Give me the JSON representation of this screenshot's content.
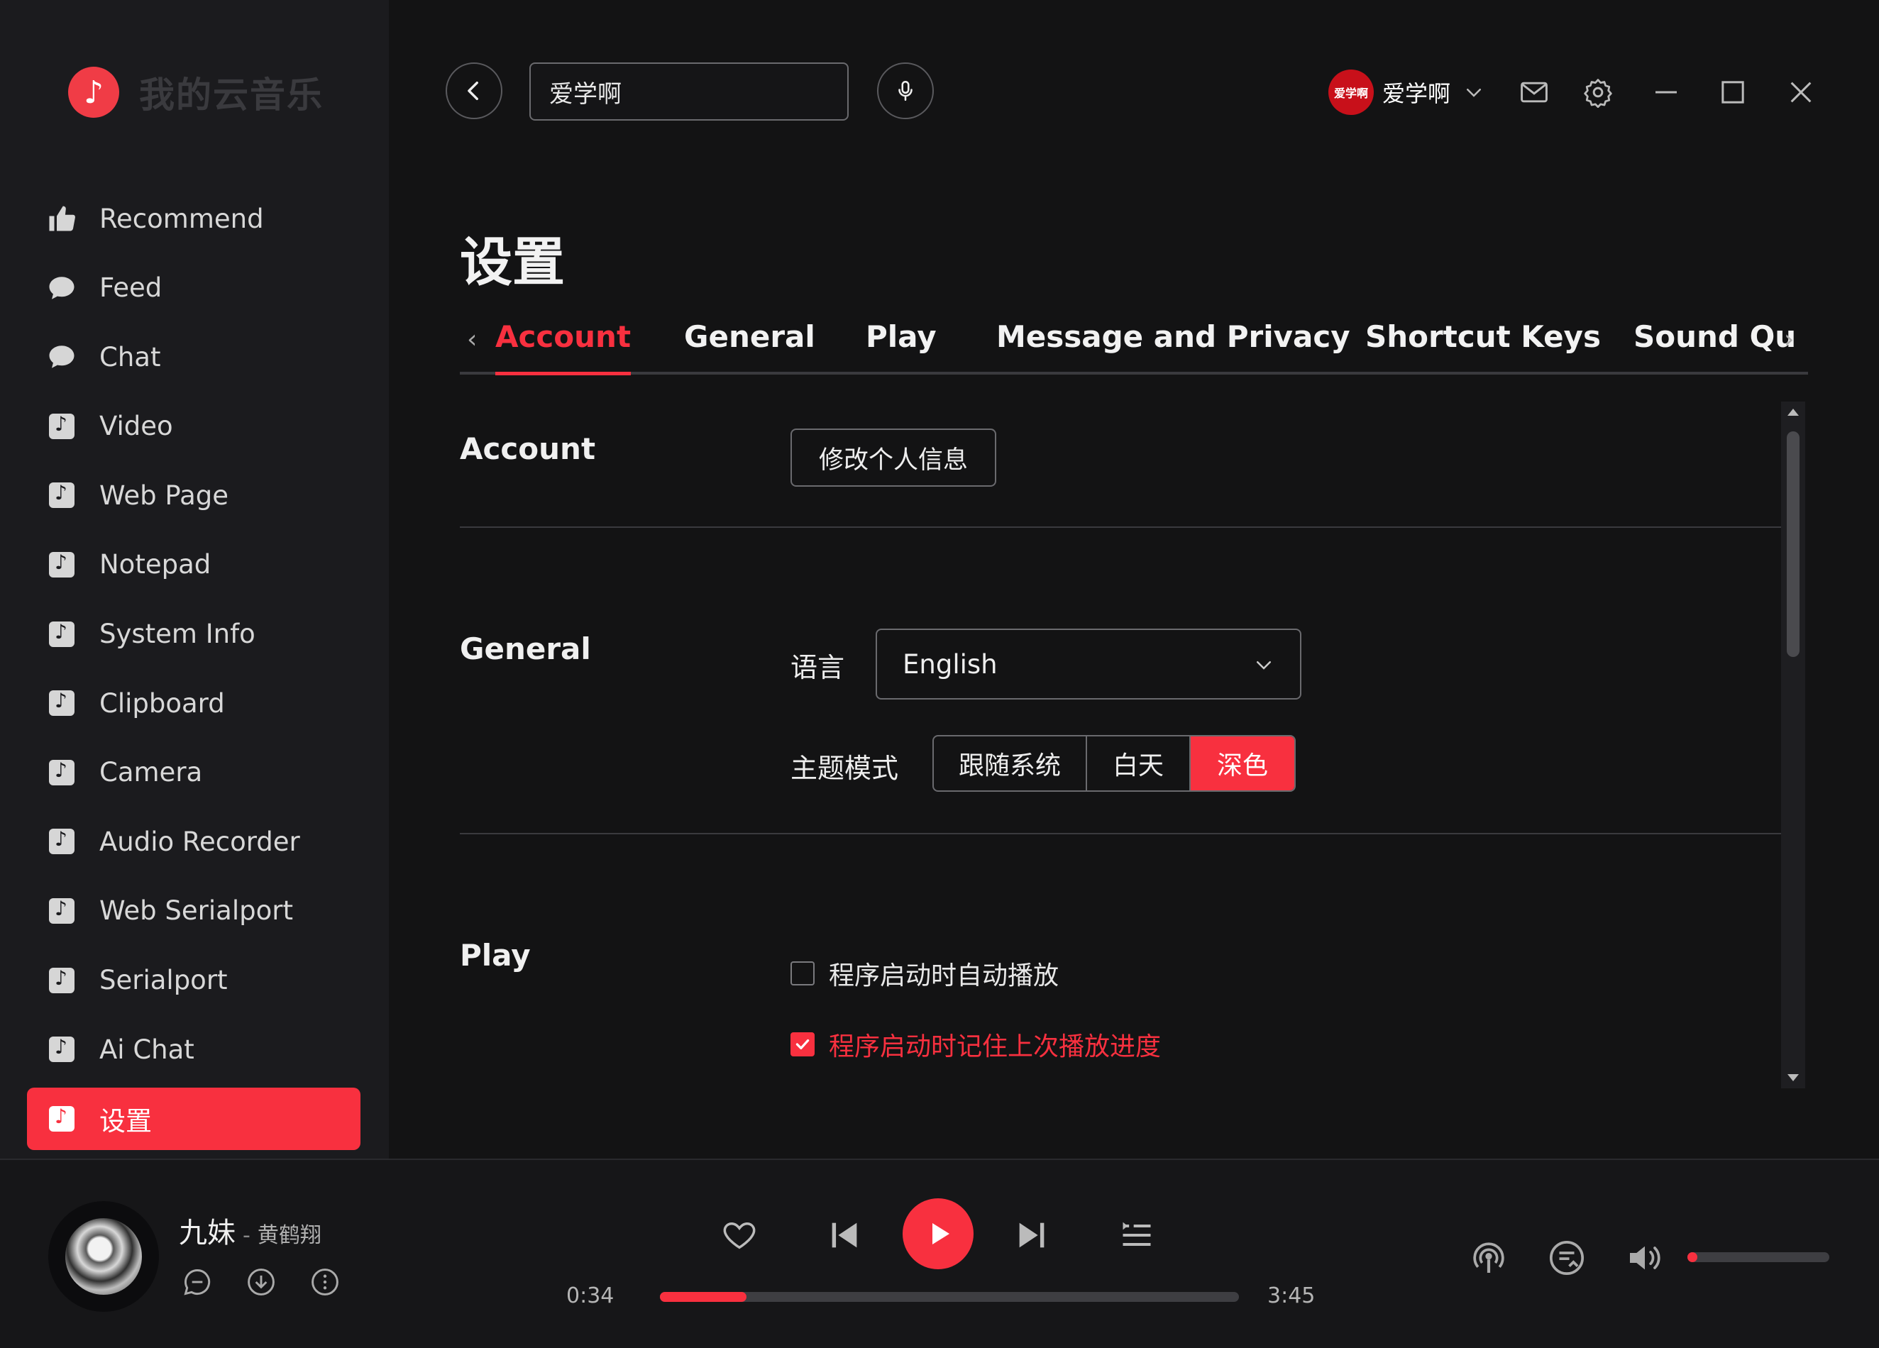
{
  "app": {
    "name": "我的云音乐"
  },
  "header": {
    "search_value": "爱学啊",
    "user_avatar_text": "爱学啊",
    "user_name": "爱学啊"
  },
  "sidebar": {
    "items": [
      {
        "label": "Recommend",
        "icon": "thumbs-up-icon"
      },
      {
        "label": "Feed",
        "icon": "chat-bubble-icon"
      },
      {
        "label": "Chat",
        "icon": "chat-bubble-icon"
      },
      {
        "label": "Video",
        "icon": "music-note-icon"
      },
      {
        "label": "Web Page",
        "icon": "music-note-icon"
      },
      {
        "label": "Notepad",
        "icon": "music-note-icon"
      },
      {
        "label": "System Info",
        "icon": "music-note-icon"
      },
      {
        "label": "Clipboard",
        "icon": "music-note-icon"
      },
      {
        "label": "Camera",
        "icon": "music-note-icon"
      },
      {
        "label": "Audio Recorder",
        "icon": "music-note-icon"
      },
      {
        "label": "Web Serialport",
        "icon": "music-note-icon"
      },
      {
        "label": "Serialport",
        "icon": "music-note-icon"
      },
      {
        "label": "Ai Chat",
        "icon": "music-note-icon"
      },
      {
        "label": "设置",
        "icon": "music-note-icon",
        "active": true
      }
    ]
  },
  "page": {
    "title": "设置",
    "tabs": [
      "Account",
      "General",
      "Play",
      "Message and Privacy",
      "Shortcut Keys",
      "Sound Qu"
    ],
    "active_tab": "Account"
  },
  "account": {
    "label": "Account",
    "edit_button": "修改个人信息"
  },
  "general": {
    "label": "General",
    "language_label": "语言",
    "language_value": "English",
    "theme_label": "主题模式",
    "theme_options": [
      "跟随系统",
      "白天",
      "深色"
    ],
    "theme_selected": "深色"
  },
  "play": {
    "label": "Play",
    "options": [
      {
        "label": "程序启动时自动播放",
        "checked": false
      },
      {
        "label": "程序启动时记住上次播放进度",
        "checked": true
      }
    ]
  },
  "player": {
    "song_title": "九妹",
    "separator": "-",
    "artist": "黄鹤翔",
    "current_time": "0:34",
    "total_time": "3:45",
    "progress": 0.15,
    "volume": 0.07
  },
  "colors": {
    "accent": "#f8303f",
    "background": "#131314",
    "sidebar": "#1b1b1e"
  }
}
